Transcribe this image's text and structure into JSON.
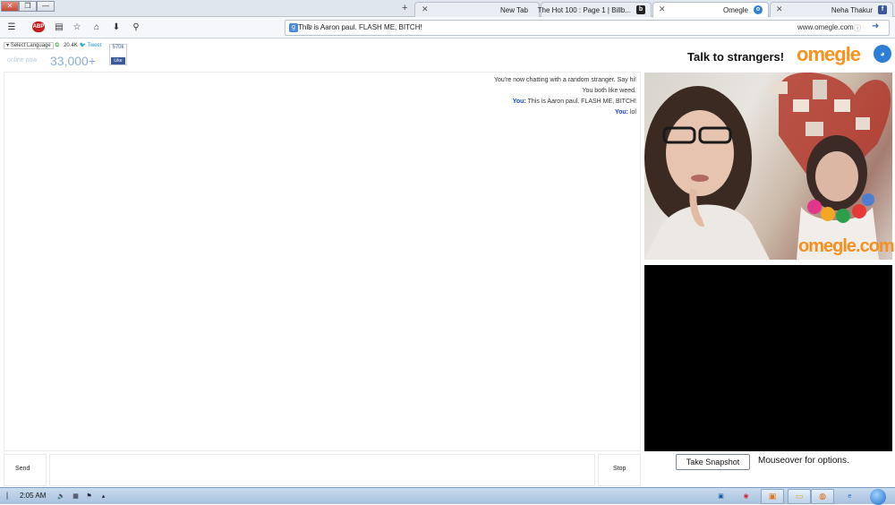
{
  "window": {
    "controls": [
      "✕",
      "❐",
      "—"
    ]
  },
  "tabs": [
    {
      "label": "Neha Thakur",
      "favicon": "facebook-icon"
    },
    {
      "label": "Omegle",
      "favicon": "omegle-icon",
      "active": true
    },
    {
      "label": "The Hot 100 : Page 1 | Billb...",
      "favicon": "billboard-icon"
    },
    {
      "label": "New Tab",
      "favicon": "none"
    }
  ],
  "toolbar": {
    "page_title": "This is Aaron paul. FLASH ME, BITCH!",
    "url": "www.omegle.com",
    "adblock_count": "ABP"
  },
  "header": {
    "logo_text": "omegle",
    "tagline": "Talk to strangers!"
  },
  "social": {
    "tweet_label": "Tweet",
    "tweet_count": "20.4K",
    "fb_count": "570k",
    "fb_like": "Like",
    "select_language": "Select Language",
    "online_count": "33,000+",
    "online_label": "online now"
  },
  "chat": {
    "messages": [
      {
        "who": "",
        "text": "You're now chatting with a random stranger. Say hi!"
      },
      {
        "who": "",
        "text": "You both like weed."
      },
      {
        "who": "You:",
        "text": "This is Aaron paul. FLASH ME, BITCH!"
      },
      {
        "who": "You:",
        "text": "lol"
      }
    ]
  },
  "controls": {
    "send_label": "Send",
    "stop_label": "Stop",
    "snapshot_label": "Take Snapshot",
    "mouseover_label": "Mouseover for options."
  },
  "video": {
    "watermark": "omegle.com"
  },
  "taskbar": {
    "clock": "2:05 AM"
  },
  "colors": {
    "omegle_orange": "#f7931e",
    "omegle_blue": "#2c7ed6",
    "chat_you_blue": "#1b47c7"
  }
}
